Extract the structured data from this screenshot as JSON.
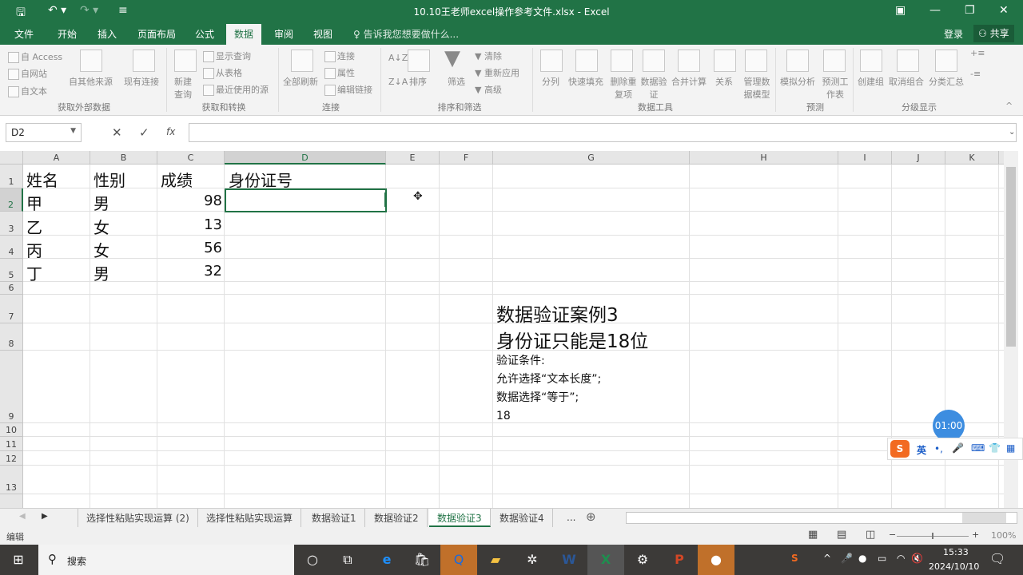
{
  "window": {
    "title": "10.10王老师excel操作参考文件.xlsx - Excel"
  },
  "ribbon_tabs": [
    "文件",
    "开始",
    "插入",
    "页面布局",
    "公式",
    "数据",
    "审阅",
    "视图"
  ],
  "tell_me": "告诉我您想要做什么...",
  "login": "登录",
  "share": "共享",
  "ribbon": {
    "get_external": {
      "label": "获取外部数据",
      "items": [
        "自 Access",
        "自网站",
        "自文本",
        "自其他来源",
        "现有连接"
      ]
    },
    "get_transform": {
      "label": "获取和转换",
      "items": [
        "新建查询",
        "显示查询",
        "从表格",
        "最近使用的源"
      ]
    },
    "connections": {
      "label": "连接",
      "items": [
        "全部刷新",
        "连接",
        "属性",
        "编辑链接"
      ]
    },
    "sort_filter": {
      "label": "排序和筛选",
      "items": [
        "排序",
        "筛选",
        "清除",
        "重新应用",
        "高级"
      ]
    },
    "data_tools": {
      "label": "数据工具",
      "items": [
        "分列",
        "快速填充",
        "删除重复项",
        "数据验证",
        "合并计算",
        "关系",
        "管理数据模型"
      ]
    },
    "forecast": {
      "label": "预测",
      "items": [
        "模拟分析",
        "预测工作表"
      ]
    },
    "outline": {
      "label": "分级显示",
      "items": [
        "创建组",
        "取消组合",
        "分类汇总"
      ]
    }
  },
  "formula_bar": {
    "name_box": "D2",
    "fx": "fx",
    "value": ""
  },
  "columns": [
    "A",
    "B",
    "C",
    "D",
    "E",
    "F",
    "G",
    "H",
    "I",
    "J",
    "K"
  ],
  "rows": [
    "1",
    "2",
    "3",
    "4",
    "5",
    "6",
    "7",
    "8",
    "9",
    "10",
    "11",
    "12",
    "13"
  ],
  "cells": {
    "headers": [
      "姓名",
      "性别",
      "成绩",
      "身份证号"
    ],
    "data": [
      [
        "甲",
        "男",
        "98"
      ],
      [
        "乙",
        "女",
        "13"
      ],
      [
        "丙",
        "女",
        "56"
      ],
      [
        "丁",
        "男",
        "32"
      ]
    ],
    "G7": "数据验证案例3",
    "G8": "身份证只能是18位",
    "G9": [
      "验证条件:",
      "允许选择“文本长度”;",
      "数据选择“等于”;",
      "18"
    ]
  },
  "sheet_tabs": [
    "选择性粘贴实现运算 (2)",
    "选择性粘贴实现运算",
    "数据验证1",
    "数据验证2",
    "数据验证3",
    "数据验证4",
    "..."
  ],
  "active_sheet": "数据验证3",
  "status": {
    "mode": "编辑",
    "zoom": "100%"
  },
  "overlay": {
    "timer": "01:00",
    "ime": "英"
  },
  "taskbar": {
    "search": "搜索",
    "time": "15:33",
    "date": "2024/10/10"
  },
  "colors": {
    "excel_green": "#217346"
  }
}
